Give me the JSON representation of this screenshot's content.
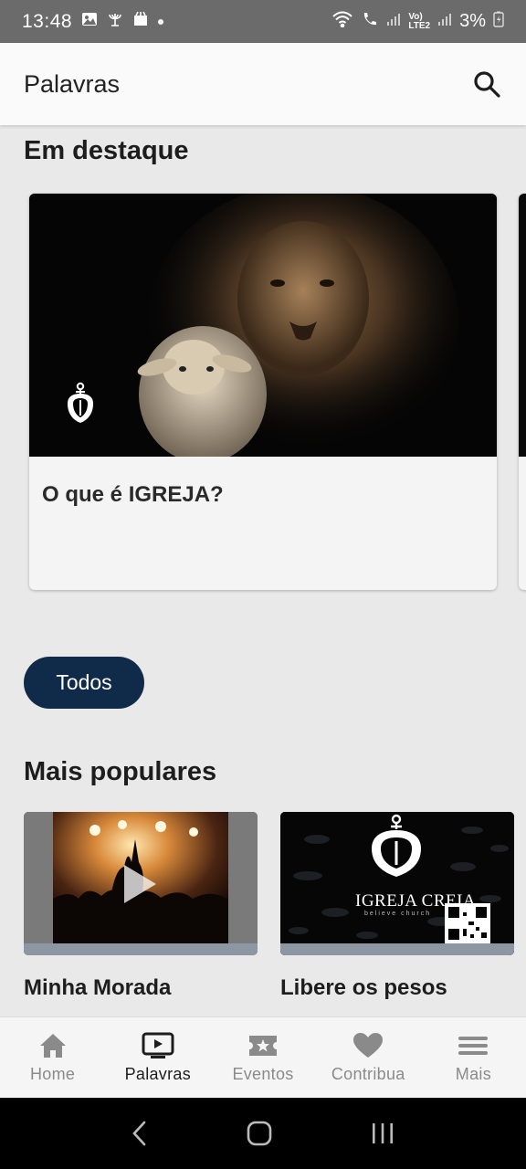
{
  "status_bar": {
    "time": "13:48",
    "battery": "3%"
  },
  "app_bar": {
    "title": "Palavras",
    "search_icon": "search-icon"
  },
  "featured": {
    "heading": "Em destaque",
    "card": {
      "title": "O que é IGREJA?"
    }
  },
  "filters": {
    "chip_label": "Todos"
  },
  "popular": {
    "heading": "Mais populares",
    "items": [
      {
        "title": "Minha Morada"
      },
      {
        "title": "Libere os pesos",
        "logo_text": "IGREJA CREIA",
        "logo_subtext": "believe church"
      }
    ]
  },
  "bottom_nav": {
    "items": [
      {
        "label": "Home",
        "icon": "home-icon"
      },
      {
        "label": "Palavras",
        "icon": "video-icon"
      },
      {
        "label": "Eventos",
        "icon": "ticket-icon"
      },
      {
        "label": "Contribua",
        "icon": "heart-icon"
      },
      {
        "label": "Mais",
        "icon": "menu-icon"
      }
    ],
    "active_index": 1
  },
  "colors": {
    "chip_bg": "#102a4a",
    "active_nav": "#1d1d1d",
    "inactive_nav": "#8a8a8a"
  }
}
